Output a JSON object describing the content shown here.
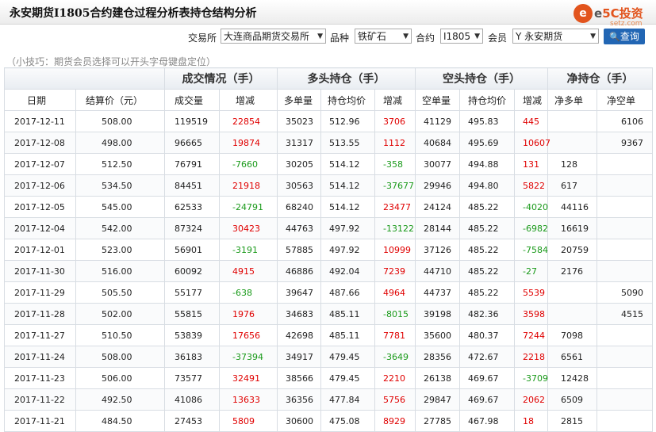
{
  "title": "永安期货I1805合约建仓过程分析表持仓结构分析",
  "logo": {
    "glyph": "e",
    "brand_part1": "e",
    "brand_part2": "5C投资",
    "site": "setz.com"
  },
  "filters": {
    "exchange_label": "交易所",
    "exchange_value": "大连商品期货交易所",
    "variety_label": "品种",
    "variety_value": "铁矿石",
    "contract_label": "合约",
    "contract_value": "I1805",
    "member_label": "会员",
    "member_value": "Y 永安期货",
    "query_label": "查询"
  },
  "tip": "（小技巧：期货会员选择可以开头字母键盘定位）",
  "groups": {
    "blank": "",
    "trade": "成交情况（手）",
    "long": "多头持仓（手）",
    "short": "空头持仓（手）",
    "net": "净持仓（手）"
  },
  "columns": [
    "日期",
    "结算价（元）",
    "成交量",
    "增减",
    "多单量",
    "持仓均价",
    "增减",
    "空单量",
    "持仓均价",
    "增减",
    "净多单",
    "净空单"
  ],
  "rows": [
    [
      "2017-12-11",
      "508.00",
      "119519",
      "22854",
      "35023",
      "512.96",
      "3706",
      "41129",
      "495.83",
      "445",
      "",
      "6106"
    ],
    [
      "2017-12-08",
      "498.00",
      "96665",
      "19874",
      "31317",
      "513.55",
      "1112",
      "40684",
      "495.69",
      "10607",
      "",
      "9367"
    ],
    [
      "2017-12-07",
      "512.50",
      "76791",
      "-7660",
      "30205",
      "514.12",
      "-358",
      "30077",
      "494.88",
      "131",
      "128",
      ""
    ],
    [
      "2017-12-06",
      "534.50",
      "84451",
      "21918",
      "30563",
      "514.12",
      "-37677",
      "29946",
      "494.80",
      "5822",
      "617",
      ""
    ],
    [
      "2017-12-05",
      "545.00",
      "62533",
      "-24791",
      "68240",
      "514.12",
      "23477",
      "24124",
      "485.22",
      "-4020",
      "44116",
      ""
    ],
    [
      "2017-12-04",
      "542.00",
      "87324",
      "30423",
      "44763",
      "497.92",
      "-13122",
      "28144",
      "485.22",
      "-6982",
      "16619",
      ""
    ],
    [
      "2017-12-01",
      "523.00",
      "56901",
      "-3191",
      "57885",
      "497.92",
      "10999",
      "37126",
      "485.22",
      "-7584",
      "20759",
      ""
    ],
    [
      "2017-11-30",
      "516.00",
      "60092",
      "4915",
      "46886",
      "492.04",
      "7239",
      "44710",
      "485.22",
      "-27",
      "2176",
      ""
    ],
    [
      "2017-11-29",
      "505.50",
      "55177",
      "-638",
      "39647",
      "487.66",
      "4964",
      "44737",
      "485.22",
      "5539",
      "",
      "5090"
    ],
    [
      "2017-11-28",
      "502.00",
      "55815",
      "1976",
      "34683",
      "485.11",
      "-8015",
      "39198",
      "482.36",
      "3598",
      "",
      "4515"
    ],
    [
      "2017-11-27",
      "510.50",
      "53839",
      "17656",
      "42698",
      "485.11",
      "7781",
      "35600",
      "480.37",
      "7244",
      "7098",
      ""
    ],
    [
      "2017-11-24",
      "508.00",
      "36183",
      "-37394",
      "34917",
      "479.45",
      "-3649",
      "28356",
      "472.67",
      "2218",
      "6561",
      ""
    ],
    [
      "2017-11-23",
      "506.00",
      "73577",
      "32491",
      "38566",
      "479.45",
      "2210",
      "26138",
      "469.67",
      "-3709",
      "12428",
      ""
    ],
    [
      "2017-11-22",
      "492.50",
      "41086",
      "13633",
      "36356",
      "477.84",
      "5756",
      "29847",
      "469.67",
      "2062",
      "6509",
      ""
    ],
    [
      "2017-11-21",
      "484.50",
      "27453",
      "5809",
      "30600",
      "475.08",
      "8929",
      "27785",
      "467.98",
      "18",
      "2815",
      ""
    ]
  ]
}
